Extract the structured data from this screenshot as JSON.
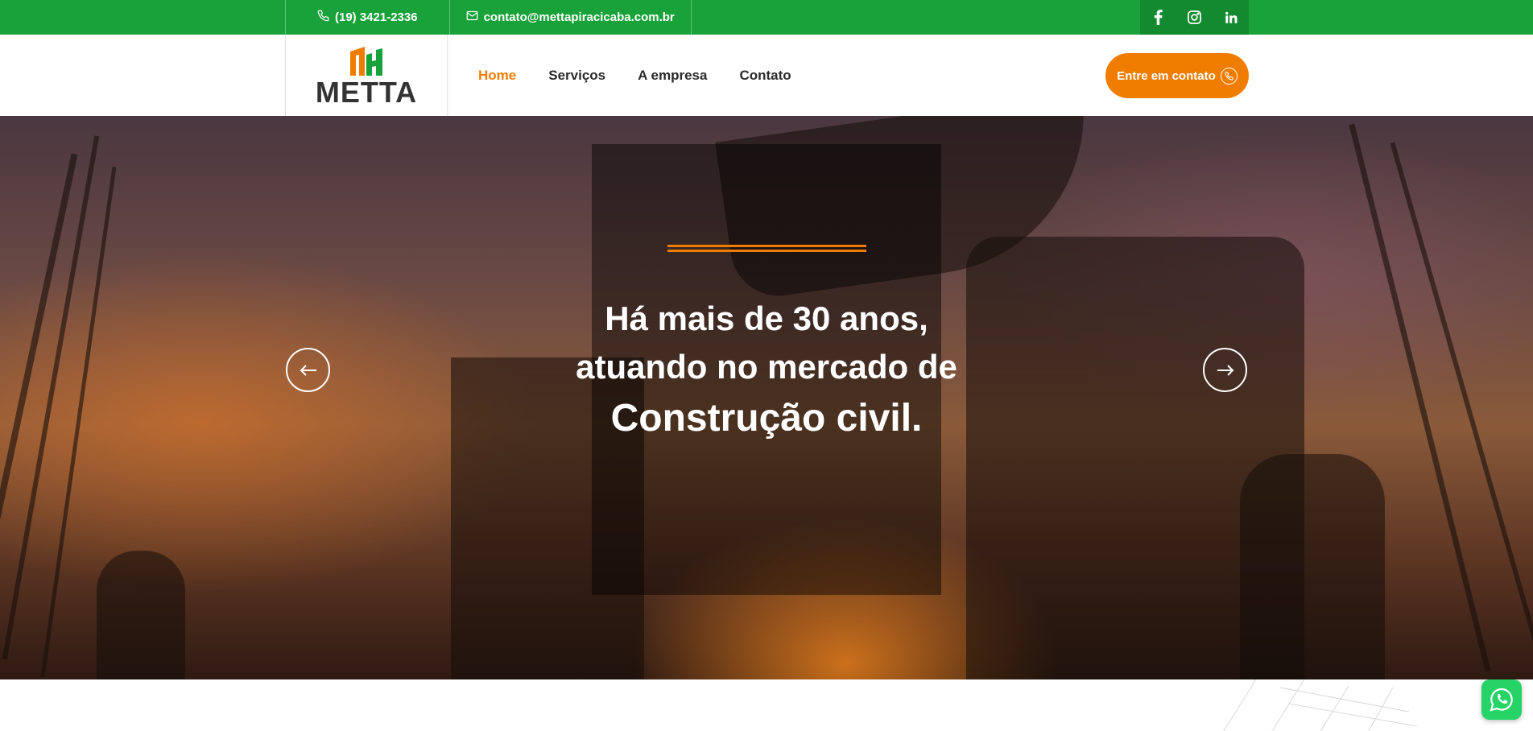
{
  "topbar": {
    "phone": "(19) 3421-2336",
    "email": "contato@mettapiracicaba.com.br",
    "social": [
      "facebook-icon",
      "instagram-icon",
      "linkedin-icon"
    ],
    "bg_color": "#19a23a"
  },
  "header": {
    "logo_text": "METTA",
    "nav": {
      "home": "Home",
      "services": "Serviços",
      "company": "A empresa",
      "contact": "Contato"
    },
    "cta_label": "Entre em contato",
    "accent_color": "#f07d00"
  },
  "hero": {
    "line1": "Há mais de 30 anos,",
    "line2": "atuando no mercado de",
    "line3": "Construção civil."
  }
}
